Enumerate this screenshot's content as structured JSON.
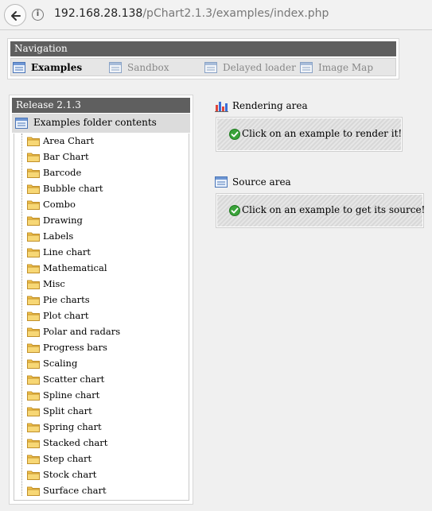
{
  "browser": {
    "url_host": "192.168.28.138",
    "url_path": "/pChart2.1.3/examples/index.php"
  },
  "navigation": {
    "title": "Navigation",
    "items": [
      {
        "label": "Examples",
        "active": true
      },
      {
        "label": "Sandbox",
        "active": false
      },
      {
        "label": "Delayed loader",
        "active": false
      },
      {
        "label": "Image Map",
        "active": false
      }
    ]
  },
  "release_panel": {
    "title": "Release 2.1.3",
    "folder_header": "Examples folder contents",
    "folders": [
      "Area Chart",
      "Bar Chart",
      "Barcode",
      "Bubble chart",
      "Combo",
      "Drawing",
      "Labels",
      "Line chart",
      "Mathematical",
      "Misc",
      "Pie charts",
      "Plot chart",
      "Polar and radars",
      "Progress bars",
      "Scaling",
      "Scatter chart",
      "Spline chart",
      "Split chart",
      "Spring chart",
      "Stacked chart",
      "Step chart",
      "Stock chart",
      "Surface chart"
    ]
  },
  "rendering_area": {
    "title": "Rendering area",
    "message": "Click on an example to render it!"
  },
  "source_area": {
    "title": "Source area",
    "message": "Click on an example to get its source!"
  },
  "colors": {
    "panel_title_bg": "#5f5f5f",
    "check_green": "#3aa33a",
    "folder_yellow": "#f2c24a"
  },
  "icons": {
    "back": "back-arrow-icon",
    "info": "info-icon",
    "nav": "window-icon",
    "folder": "folder-icon",
    "chart": "bar-chart-icon",
    "check": "check-circle-icon"
  }
}
